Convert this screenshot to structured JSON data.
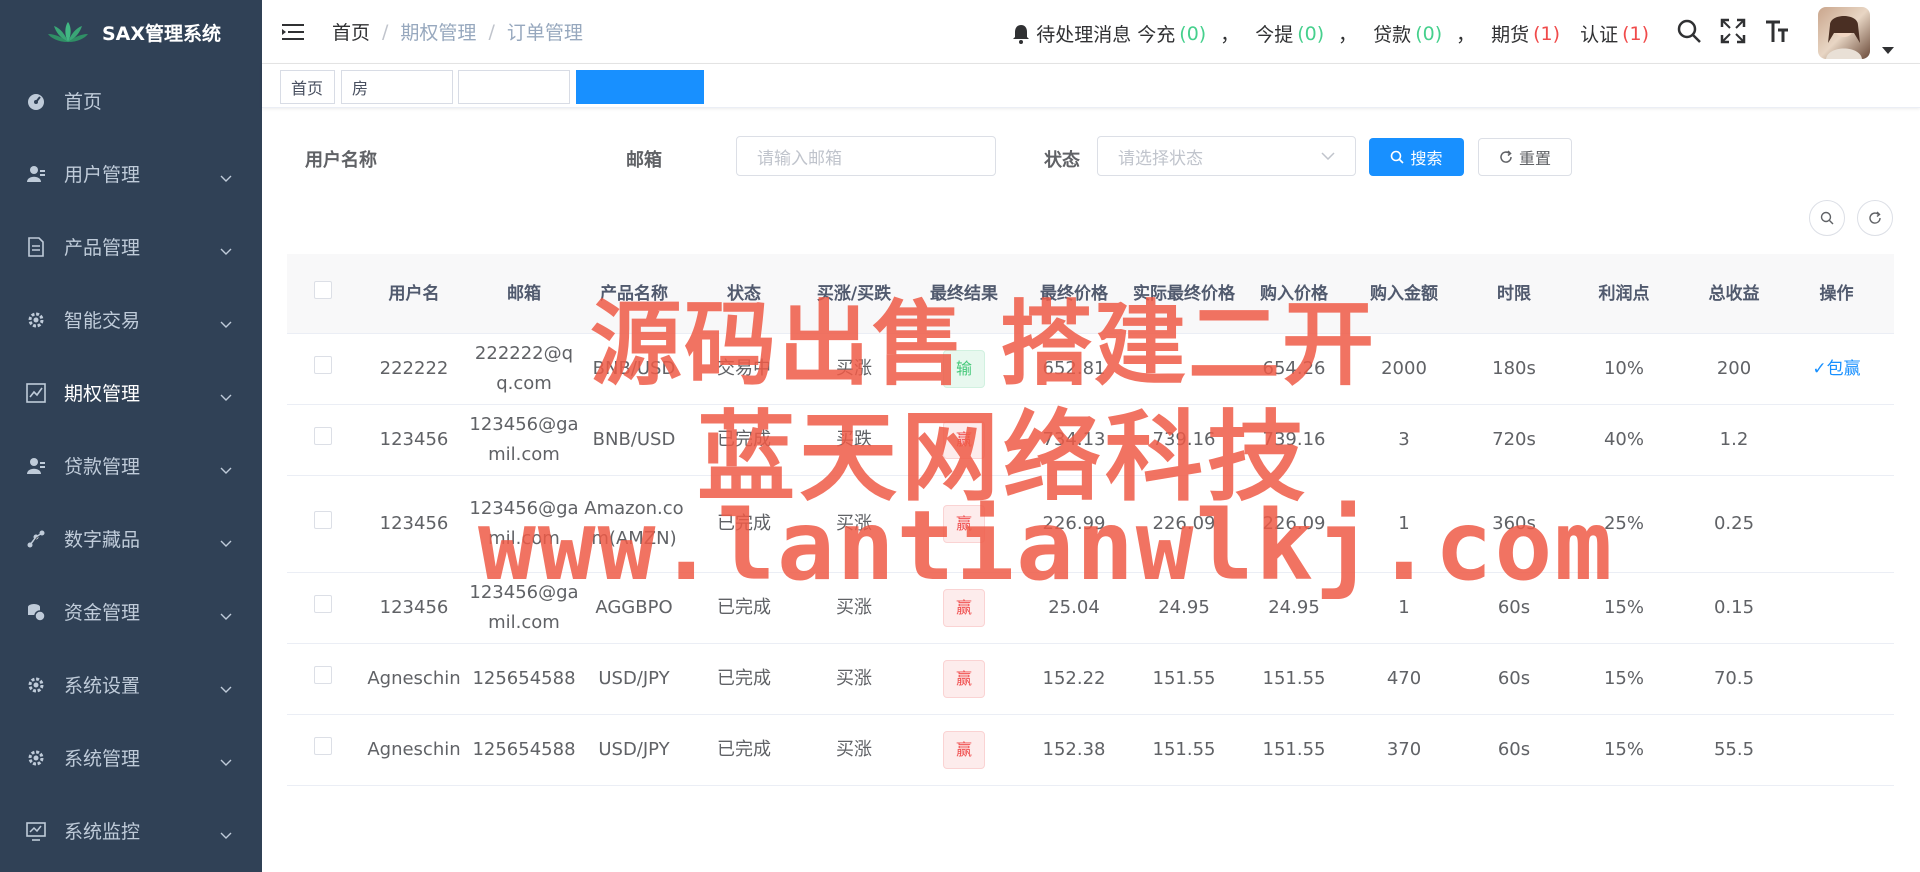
{
  "app": {
    "title": "SAX管理系统"
  },
  "sidebar": {
    "items": [
      {
        "label": "首页",
        "icon": "dashboard-icon"
      },
      {
        "label": "用户管理",
        "icon": "user-icon"
      },
      {
        "label": "产品管理",
        "icon": "document-icon"
      },
      {
        "label": "智能交易",
        "icon": "gear-icon"
      },
      {
        "label": "期权管理",
        "icon": "chart-icon"
      },
      {
        "label": "贷款管理",
        "icon": "user-icon"
      },
      {
        "label": "数字藏品",
        "icon": "nodes-icon"
      },
      {
        "label": "资金管理",
        "icon": "money-icon"
      },
      {
        "label": "系统设置",
        "icon": "gear-icon"
      },
      {
        "label": "系统管理",
        "icon": "gear-icon"
      },
      {
        "label": "系统监控",
        "icon": "monitor-icon"
      }
    ]
  },
  "header": {
    "breadcrumb": [
      "首页",
      "期权管理",
      "订单管理"
    ],
    "notice": {
      "label": "待处理消息",
      "recharge": "今充",
      "recharge_count": "(0)",
      "withdraw": "今提",
      "withdraw_count": "(0)",
      "loan": "贷款",
      "loan_count": "(0)",
      "futures": "期货",
      "futures_count": "(1)",
      "auth": "认证",
      "auth_count": "(1)",
      "comma": "，"
    }
  },
  "tags": {
    "home": "首页",
    "second": "房"
  },
  "filter": {
    "username_label": "用户名称",
    "email_label": "邮箱",
    "email_placeholder": "请输入邮箱",
    "status_label": "状态",
    "status_placeholder": "请选择状态",
    "search": "搜索",
    "reset": "重置"
  },
  "table": {
    "headers": [
      "用户名",
      "邮箱",
      "产品名称",
      "状态",
      "买涨/买跌",
      "最终结果",
      "最终价格",
      "实际最终价格",
      "购入价格",
      "购入金额",
      "时限",
      "利润点",
      "总收益",
      "操作"
    ],
    "rows": [
      {
        "user": "222222",
        "email": "222222@qq.com",
        "product": "BNB/USD",
        "status": "交易中",
        "dir": "买涨",
        "result": "输",
        "final": "652.81",
        "actual": "",
        "buy": "654.26",
        "amount": "2000",
        "period": "180s",
        "profit": "10%",
        "total": "200",
        "op": "✓包赢"
      },
      {
        "user": "123456",
        "email": "123456@gamil.com",
        "product": "BNB/USD",
        "status": "已完成",
        "dir": "买跌",
        "result": "赢",
        "final": "734.13",
        "actual": "739.16",
        "buy": "739.16",
        "amount": "3",
        "period": "720s",
        "profit": "40%",
        "total": "1.2",
        "op": ""
      },
      {
        "user": "123456",
        "email": "123456@gamil.com",
        "product": "Amazon.com(AMZN)",
        "status": "已完成",
        "dir": "买涨",
        "result": "赢",
        "final": "226.99",
        "actual": "226.09",
        "buy": "226.09",
        "amount": "1",
        "period": "360s",
        "profit": "25%",
        "total": "0.25",
        "op": ""
      },
      {
        "user": "123456",
        "email": "123456@gamil.com",
        "product": "AGGBPO",
        "status": "已完成",
        "dir": "买涨",
        "result": "赢",
        "final": "25.04",
        "actual": "24.95",
        "buy": "24.95",
        "amount": "1",
        "period": "60s",
        "profit": "15%",
        "total": "0.15",
        "op": ""
      },
      {
        "user": "Agneschin",
        "email": "125654588",
        "product": "USD/JPY",
        "status": "已完成",
        "dir": "买涨",
        "result": "赢",
        "final": "152.22",
        "actual": "151.55",
        "buy": "151.55",
        "amount": "470",
        "period": "60s",
        "profit": "15%",
        "total": "70.5",
        "op": ""
      },
      {
        "user": "Agneschin",
        "email": "125654588",
        "product": "USD/JPY",
        "status": "已完成",
        "dir": "买涨",
        "result": "赢",
        "final": "152.38",
        "actual": "151.55",
        "buy": "151.55",
        "amount": "370",
        "period": "60s",
        "profit": "15%",
        "total": "55.5",
        "op": ""
      }
    ]
  },
  "watermark": {
    "line1": "源码出售 搭建二开",
    "line2": "蓝天网络科技",
    "line3": "www.lantianwlkj.com"
  },
  "colors": {
    "sidebar": "#304156",
    "primary": "#1890ff",
    "win": "#f05050",
    "lose": "#46c87a",
    "watermark": "#ee5a46"
  }
}
